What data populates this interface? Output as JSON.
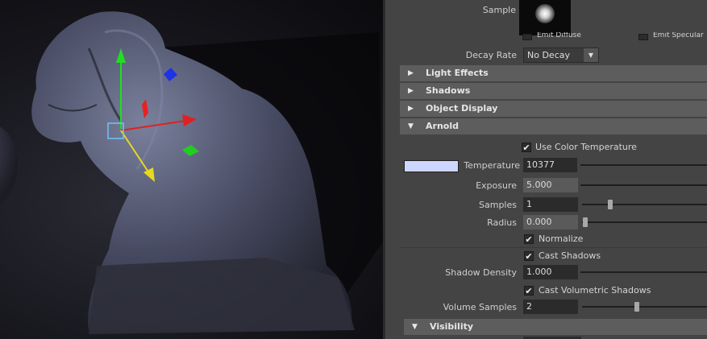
{
  "viewport": {
    "scene": "lion-sculpture"
  },
  "panel": {
    "sample_label": "Sample",
    "partial_checks": {
      "emit_diffuse": "Emit Diffuse",
      "emit_specular": "Emit Specular"
    },
    "decay_rate_label": "Decay Rate",
    "decay_rate_value": "No Decay",
    "sections": {
      "light_effects": "Light Effects",
      "shadows": "Shadows",
      "object_display": "Object Display",
      "arnold": "Arnold",
      "visibility": "Visibility"
    },
    "use_color_temperature": "Use Color Temperature",
    "temperature_label": "Temperature",
    "temperature_value": "10377",
    "temperature_swatch": "#cdd6ff",
    "exposure_label": "Exposure",
    "exposure_value": "5.000",
    "samples_label": "Samples",
    "samples_value": "1",
    "radius_label": "Radius",
    "radius_value": "0.000",
    "normalize_label": "Normalize",
    "cast_shadows_label": "Cast Shadows",
    "shadow_density_label": "Shadow Density",
    "shadow_density_value": "1.000",
    "cast_volumetric_label": "Cast Volumetric Shadows",
    "volume_samples_label": "Volume Samples",
    "volume_samples_value": "2",
    "check_glyph": "✔",
    "arrow_glyph": "▼"
  }
}
